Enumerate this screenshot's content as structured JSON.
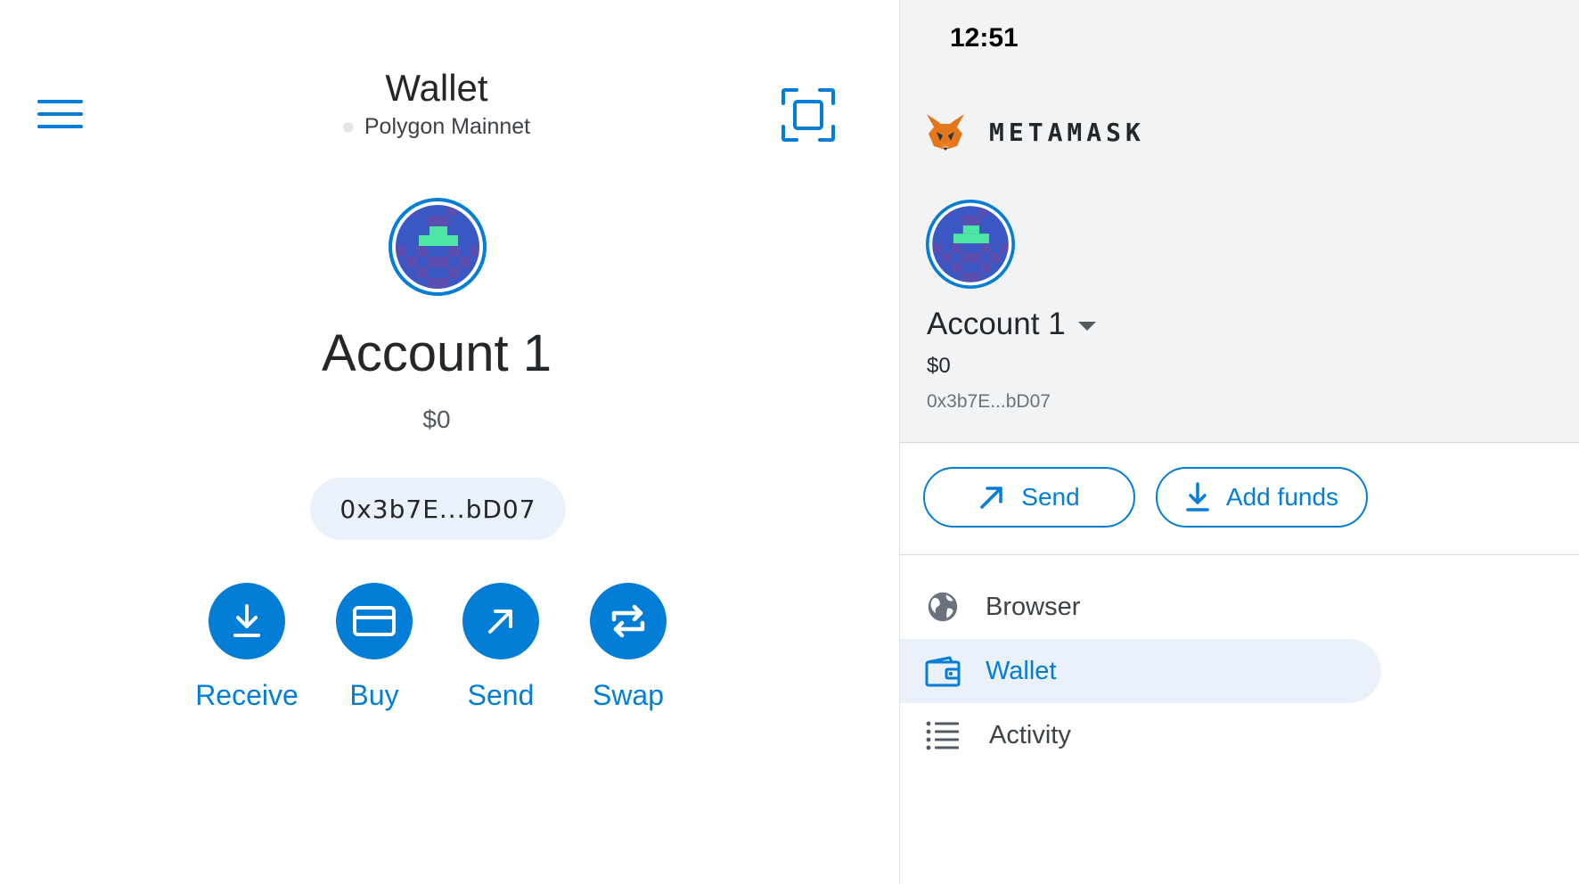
{
  "header": {
    "title": "Wallet",
    "network": "Polygon Mainnet"
  },
  "account": {
    "name": "Account 1",
    "balance": "$0",
    "address": "0x3b7E...bD07"
  },
  "actions": [
    {
      "label": "Receive",
      "icon": "download-icon"
    },
    {
      "label": "Buy",
      "icon": "card-icon"
    },
    {
      "label": "Send",
      "icon": "arrow-up-right-icon"
    },
    {
      "label": "Swap",
      "icon": "swap-icon"
    }
  ],
  "drawer": {
    "time": "12:51",
    "brand": "METAMASK",
    "account_name": "Account 1",
    "balance": "$0",
    "address": "0x3b7E...bD07",
    "send_label": "Send",
    "add_funds_label": "Add funds",
    "nav": [
      {
        "label": "Browser",
        "icon": "globe-icon"
      },
      {
        "label": "Wallet",
        "icon": "wallet-icon",
        "active": true
      },
      {
        "label": "Activity",
        "icon": "list-icon"
      }
    ]
  },
  "colors": {
    "accent": "#037dd6",
    "pill_bg": "#eaf1fb",
    "drawer_bg": "#f2f3f4"
  }
}
